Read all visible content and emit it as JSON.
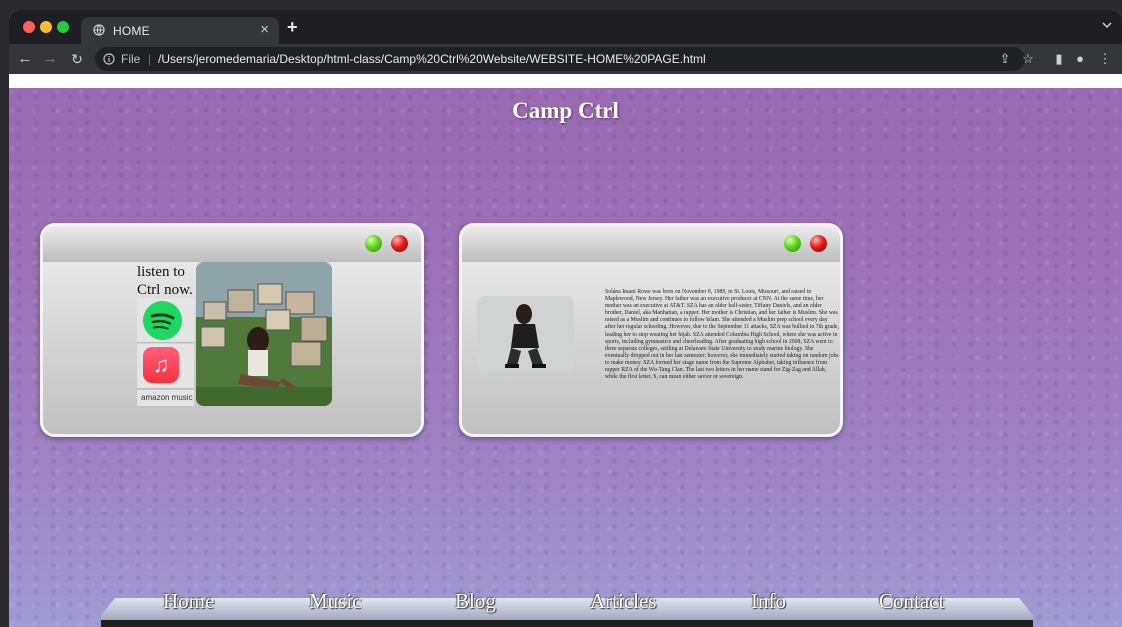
{
  "browser": {
    "tab_title": "HOME",
    "tab_close": "×",
    "new_tab": "+",
    "scheme": "File",
    "separator": "|",
    "url": "/Users/jeromedemaria/Desktop/html-class/Camp%20Ctrl%20Website/WEBSITE-HOME%20PAGE.html",
    "icons": [
      "back-arrow-icon",
      "forward-arrow-icon",
      "reload-icon",
      "info-icon",
      "share-icon",
      "bookmark-star-icon",
      "sidebar-icon",
      "profile-icon",
      "menu-icon",
      "tab-dropdown-icon"
    ]
  },
  "page": {
    "title": "Camp Ctrl"
  },
  "music_card": {
    "listen_text": "listen to Ctrl now.",
    "services": [
      {
        "name": "Spotify",
        "icon": "spotify-icon"
      },
      {
        "name": "Apple Music",
        "icon": "apple-music-icon"
      },
      {
        "name": "Amazon Music",
        "label": "amazon music",
        "icon": "amazon-music-icon"
      }
    ],
    "image": "album-cover-image"
  },
  "bio_card": {
    "image": "artist-photo",
    "bio": "Solána Imani Rowe was born on November 8, 1989, in St. Louis, Missouri, and raised in Maplewood, New Jersey. Her father was an executive producer at CNN. At the same time, her mother was an executive at AT&T. SZA has an older half-sister, Tiffany Daniels, and an older brother, Daniel, aka Manhattan, a rapper. Her mother is Christian, and her father is Muslim. She was raised as a Muslim and continues to follow Islam. She attended a Muslim prep school every day after her regular schooling. However, due to the September 11 attacks, SZA was bullied in 7th grade, leading her to stop wearing her hijab. SZA attended Columbia High School, where she was active in sports, including gymnastics and cheerleading. After graduating high school in 2008, SZA went to three separate colleges, settling at Delaware State University to study marine biology. She eventually dropped out in her last semester; however, she immediately started taking on random jobs to make money. SZA formed her stage name from the Supreme Alphabet, taking influence from rapper RZA of the Wu-Tang Clan. The last two letters in her name stand for Zig-Zag and Allah, while the first letter, S, can mean either savior or sovereign."
  },
  "nav": {
    "items": [
      "Home",
      "Music",
      "Blog",
      "Articles",
      "Info",
      "Contact"
    ]
  },
  "colors": {
    "accent_purple": "#9a69b2",
    "green_button": "#5ed51c",
    "red_button": "#e51b1b",
    "spotify": "#1ed760",
    "apple_music": "#f8323e"
  }
}
